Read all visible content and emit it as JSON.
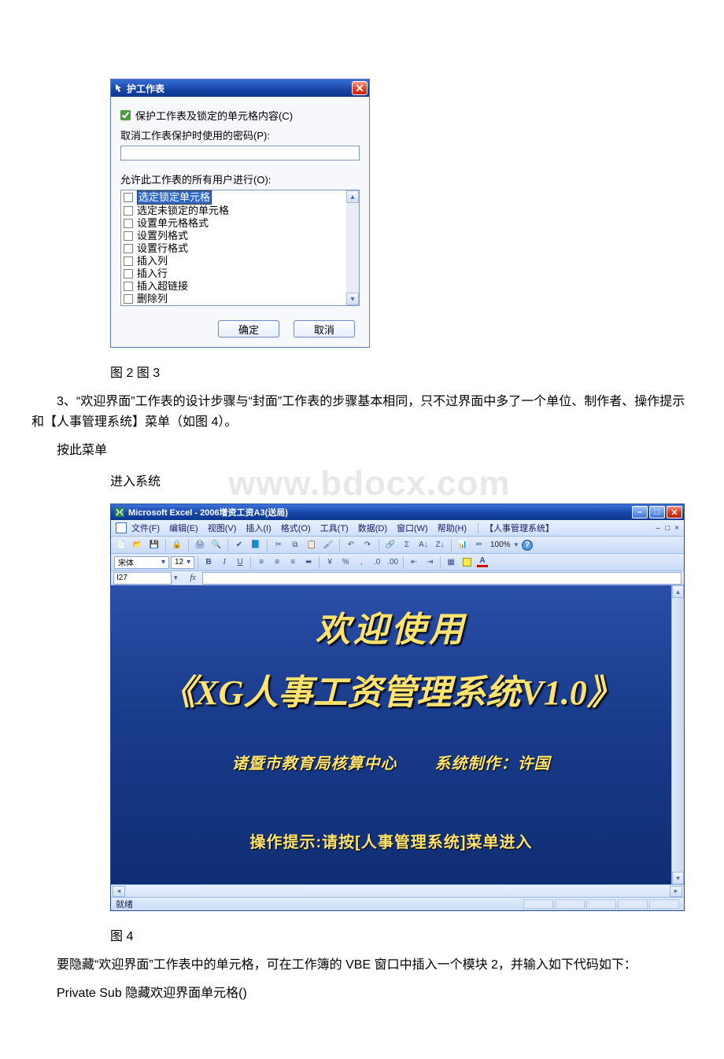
{
  "dialog": {
    "title": "护工作表",
    "protect_lock_label": "保护工作表及锁定的单元格内容(C)",
    "password_label": "取消工作表保护时使用的密码(P):",
    "password_value": "",
    "allow_label": "允许此工作表的所有用户进行(O):",
    "permissions": [
      "选定锁定单元格",
      "选定未锁定的单元格",
      "设置单元格格式",
      "设置列格式",
      "设置行格式",
      "插入列",
      "插入行",
      "插入超链接",
      "删除列"
    ],
    "ok_label": "确定",
    "cancel_label": "取消"
  },
  "captions": {
    "fig23": "图 2  图 3",
    "fig4": "图 4"
  },
  "paragraphs": {
    "p1_prefix": "3、",
    "p1": "“欢迎界面”工作表的设计步骤与“封面”工作表的步骤基本相同，只不过界面中多了一个单位、制作者、操作提示和【人事管理系统】菜单（如图 4）。",
    "p2": "按此菜单",
    "p3": "进入系统",
    "p4": "要隐藏“欢迎界面”工作表中的单元格，可在工作簿的 VBE 窗口中插入一个模块 2，并输入如下代码如下：",
    "code_line": "Private Sub 隐藏欢迎界面单元格()"
  },
  "watermark": "www.bdocx.com",
  "excel": {
    "app_title": "Microsoft Excel - 2006增资工资A3(送局)",
    "menus": {
      "file": "文件(F)",
      "edit": "编辑(E)",
      "view": "视图(V)",
      "insert": "插入(I)",
      "format": "格式(O)",
      "tools": "工具(T)",
      "data": "数据(D)",
      "window": "窗口(W)",
      "help": "帮助(H)",
      "custom": "【人事管理系统】"
    },
    "zoom": "100%",
    "font_name": "宋体",
    "font_size": "12",
    "name_box": "I27",
    "formula": "",
    "welcome_title": "欢迎使用",
    "system_name": "《XG人事工资管理系统V1.0》",
    "org": "诸暨市教育局核算中心",
    "author": "系统制作：许国",
    "op_hint": "操作提示:请按[人事管理系统]菜单进入",
    "status": "就绪"
  }
}
